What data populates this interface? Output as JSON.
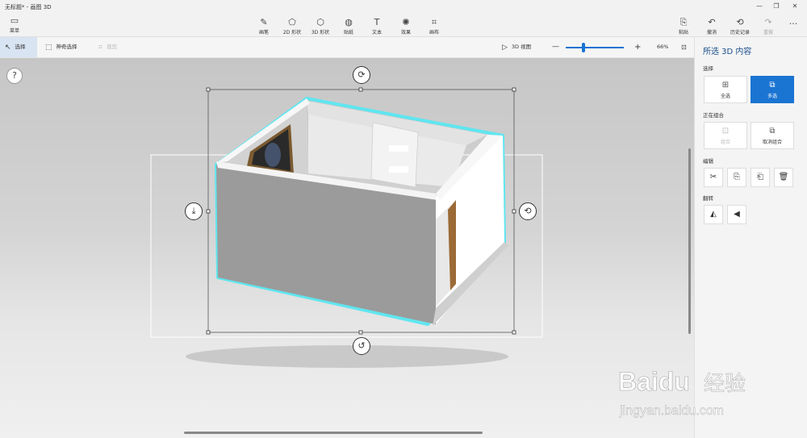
{
  "window": {
    "title": "无标题* - 画图 3D",
    "min": "—",
    "max": "❐",
    "close": "✕"
  },
  "menu": {
    "icon": "folder-icon",
    "label": "菜单"
  },
  "tools": [
    {
      "id": "brushes",
      "icon": "brush-icon",
      "glyph": "✎",
      "label": "画笔"
    },
    {
      "id": "2d",
      "icon": "2d-shape-icon",
      "glyph": "⬠",
      "label": "2D 形状"
    },
    {
      "id": "3d",
      "icon": "3d-shape-icon",
      "glyph": "⬡",
      "label": "3D 形状"
    },
    {
      "id": "stickers",
      "icon": "sticker-icon",
      "glyph": "◍",
      "label": "贴纸"
    },
    {
      "id": "text",
      "icon": "text-icon",
      "glyph": "T",
      "label": "文本"
    },
    {
      "id": "effects",
      "icon": "effects-icon",
      "glyph": "✺",
      "label": "效果"
    },
    {
      "id": "canvas",
      "icon": "canvas-icon",
      "glyph": "⌗",
      "label": "画布"
    }
  ],
  "right_tools": [
    {
      "id": "paste",
      "icon": "paste-icon",
      "glyph": "📋",
      "label": "粘贴"
    },
    {
      "id": "undo",
      "icon": "undo-icon",
      "glyph": "↶",
      "label": "撤消"
    },
    {
      "id": "history",
      "icon": "history-icon",
      "glyph": "⟲",
      "label": "历史记录"
    },
    {
      "id": "redo",
      "icon": "redo-icon",
      "glyph": "↷",
      "label": "重做"
    },
    {
      "id": "more",
      "icon": "more-icon",
      "glyph": "···",
      "label": ""
    }
  ],
  "subbar": {
    "select": "选择",
    "magic_select": "神奇选择",
    "crop": "裁剪",
    "view3d": "3D 视图",
    "zoom_out": "—",
    "zoom_in": "+",
    "zoom_percent": "66%",
    "zoom_level": 0.3
  },
  "help": "?",
  "panel": {
    "title": "所选 3D 内容",
    "select_label": "选择",
    "select_all": "全选",
    "multi_select": "多选",
    "group_label": "正在组合",
    "group": "组合",
    "ungroup": "取消组合",
    "edit_label": "编辑",
    "flip_label": "翻转"
  },
  "watermark": {
    "brand": "Baidu",
    "cn": "经验",
    "url": "jingyan.baidu.com"
  },
  "colors": {
    "accent": "#1a74d2",
    "selection_glow": "#5fe6f0"
  }
}
